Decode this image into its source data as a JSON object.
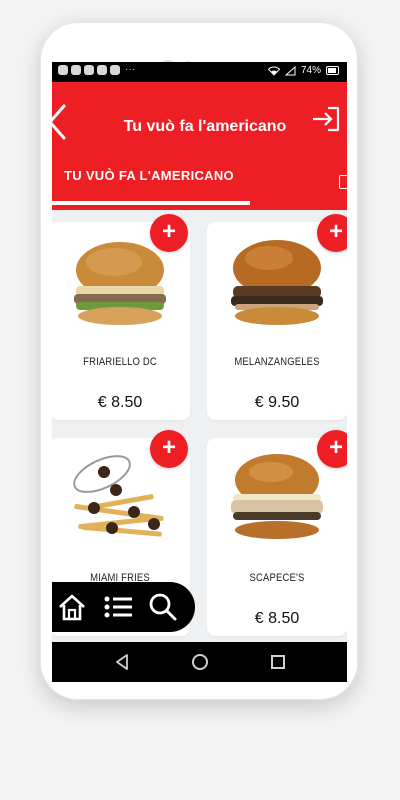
{
  "header": {
    "title": "Tu vuò fa l'americano",
    "tab_label": "TU VUÒ FA L'AMERICANO"
  },
  "status_bar": {
    "battery": "74%"
  },
  "products": [
    {
      "name": "FRIARIELLO DC",
      "price": "€ 8.50"
    },
    {
      "name": "MELANZANGELES",
      "price": "€ 9.50"
    },
    {
      "name": "MIAMI FRIES",
      "price": ""
    },
    {
      "name": "SCAPECE'S",
      "price": "€ 8.50"
    }
  ],
  "add_button_label": "+",
  "colors": {
    "brand_red": "#ee1e25",
    "background": "#eef0f1"
  },
  "icons": {
    "back": "chevron-left-icon",
    "login": "login-arrow-icon",
    "home": "home-icon",
    "menu": "list-icon",
    "search": "search-icon"
  }
}
